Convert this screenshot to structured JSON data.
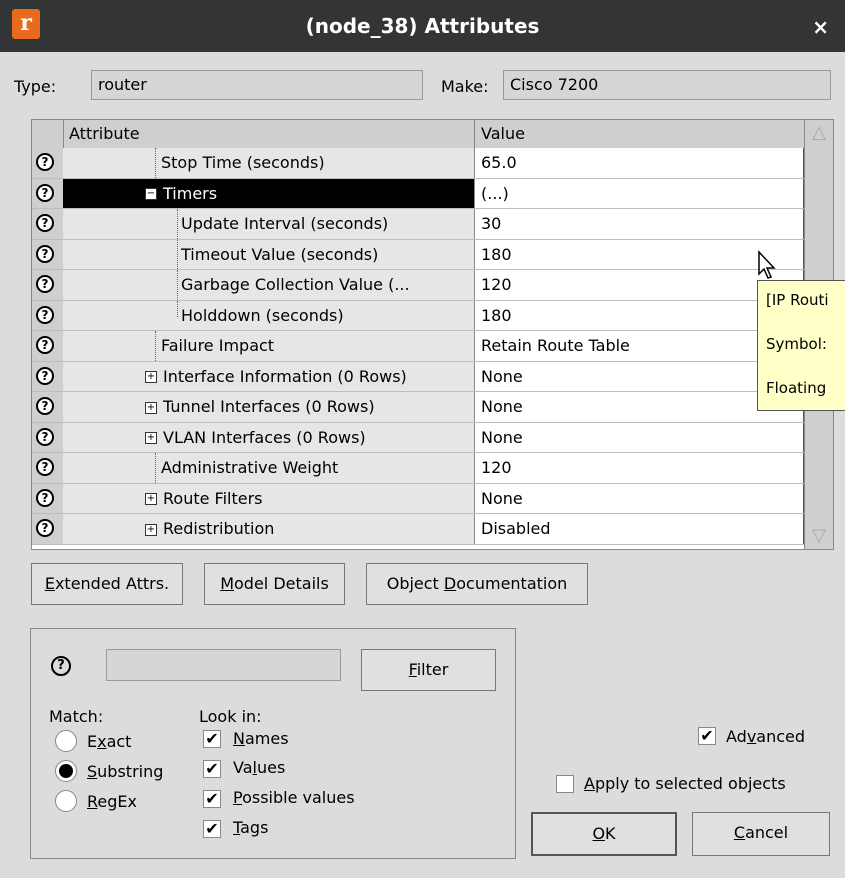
{
  "window": {
    "title": "(node_38) Attributes",
    "icon_letter": "r",
    "close_glyph": "×"
  },
  "type_field": {
    "label": "Type:",
    "value": "router"
  },
  "make_field": {
    "label": "Make:",
    "value": "Cisco 7200"
  },
  "table": {
    "headers": {
      "attribute": "Attribute",
      "value": "Value"
    },
    "rows": [
      {
        "attr": "Stop Time (seconds)",
        "value": "65.0"
      },
      {
        "attr": "Timers",
        "value": "(...)",
        "expander": "−"
      },
      {
        "attr": "Update Interval (seconds)",
        "value": "30"
      },
      {
        "attr": "Timeout Value (seconds)",
        "value": "180"
      },
      {
        "attr": "Garbage Collection Value (...",
        "value": "120"
      },
      {
        "attr": "Holddown (seconds)",
        "value": "180"
      },
      {
        "attr": "Failure Impact",
        "value": "Retain Route Table"
      },
      {
        "attr": "Interface Information (0 Rows)",
        "value": "None",
        "expander": "+"
      },
      {
        "attr": "Tunnel Interfaces (0 Rows)",
        "value": "None",
        "expander": "+"
      },
      {
        "attr": "VLAN Interfaces (0 Rows)",
        "value": "None",
        "expander": "+"
      },
      {
        "attr": "Administrative Weight",
        "value": "120"
      },
      {
        "attr": "Route Filters",
        "value": "None",
        "expander": "+"
      },
      {
        "attr": "Redistribution",
        "value": "Disabled",
        "expander": "+"
      }
    ]
  },
  "tooltip": {
    "line1": "[IP Routi",
    "line2": "Symbol:",
    "line3": "Floating"
  },
  "buttons": {
    "extended_attrs": {
      "mnemonic": "E",
      "rest": "xtended Attrs."
    },
    "model_details": {
      "mnemonic": "M",
      "rest": "odel Details"
    },
    "object_doc": {
      "pre": "Object ",
      "mnemonic": "D",
      "rest": "ocumentation"
    },
    "filter": {
      "mnemonic": "F",
      "rest": "ilter"
    },
    "ok": {
      "mnemonic": "O",
      "rest": "K"
    },
    "cancel": {
      "mnemonic": "C",
      "rest": "ancel"
    }
  },
  "filter": {
    "input_value": "",
    "match_label": "Match:",
    "look_in_label": "Look in:",
    "match_options": [
      {
        "pre": "E",
        "mnemonic": "x",
        "rest": "act"
      },
      {
        "pre": "",
        "mnemonic": "S",
        "rest": "ubstring"
      },
      {
        "pre": "",
        "mnemonic": "R",
        "rest": "egEx"
      }
    ],
    "look_in_options": [
      {
        "mnemonic": "N",
        "rest": "ames"
      },
      {
        "pre": "Va",
        "mnemonic": "l",
        "rest": "ues"
      },
      {
        "mnemonic": "P",
        "rest": "ossible values"
      },
      {
        "mnemonic": "T",
        "rest": "ags"
      }
    ]
  },
  "advanced": {
    "pre": "Ad",
    "mnemonic": "v",
    "rest": "anced"
  },
  "apply_selected": {
    "mnemonic": "A",
    "rest": "pply to selected objects"
  }
}
